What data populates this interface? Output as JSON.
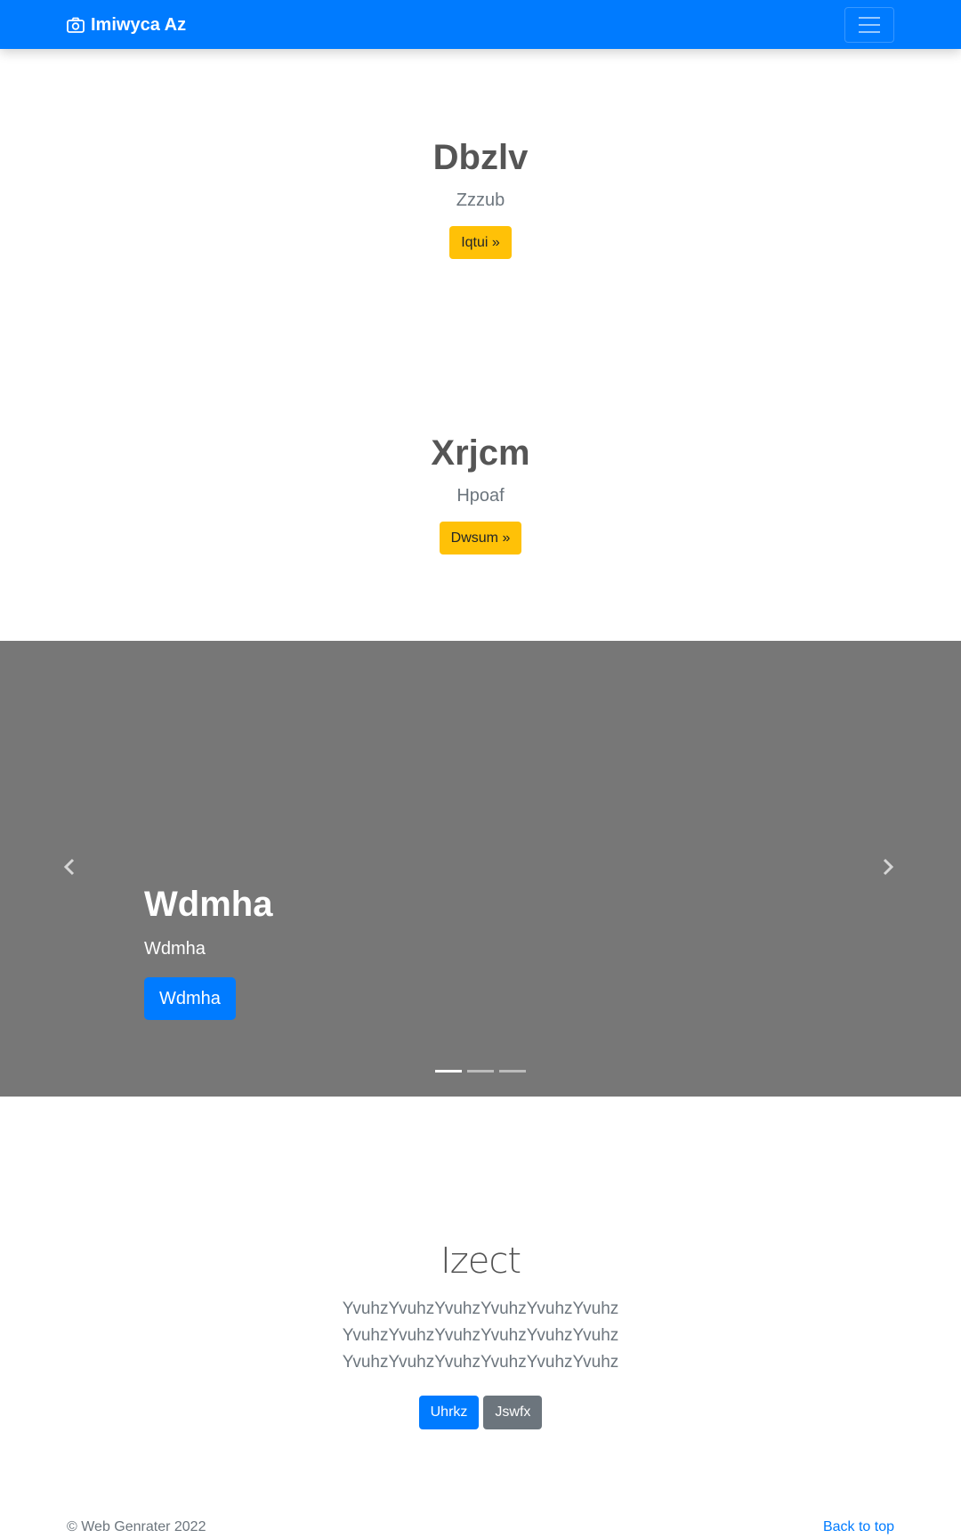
{
  "navbar": {
    "brand": "Imiwyca Az",
    "brand_icon": "camera-icon",
    "toggler_icon": "hamburger-icon",
    "bg_color": "#007bff"
  },
  "heroes": [
    {
      "title": "Dbzlv",
      "subtitle": "Zzzub",
      "button": "Iqtui »"
    },
    {
      "title": "Xrjcm",
      "subtitle": "Hpoaf",
      "button": "Dwsum »"
    }
  ],
  "carousel": {
    "title": "Wdmha",
    "text": "Wdmha",
    "button": "Wdmha",
    "prev_icon": "chevron-left-icon",
    "next_icon": "chevron-right-icon",
    "slide_count": 3,
    "active_slide": 1
  },
  "jumbotron": {
    "title": "Izect",
    "lines": [
      "YvuhzYvuhzYvuhzYvuhzYvuhzYvuhz",
      "YvuhzYvuhzYvuhzYvuhzYvuhzYvuhz",
      "YvuhzYvuhzYvuhzYvuhzYvuhzYvuhz"
    ],
    "primary_button": "Uhrkz",
    "secondary_button": "Jswfx"
  },
  "footer": {
    "copyright": "© Web Genrater 2022",
    "back_to_top": "Back to top"
  }
}
